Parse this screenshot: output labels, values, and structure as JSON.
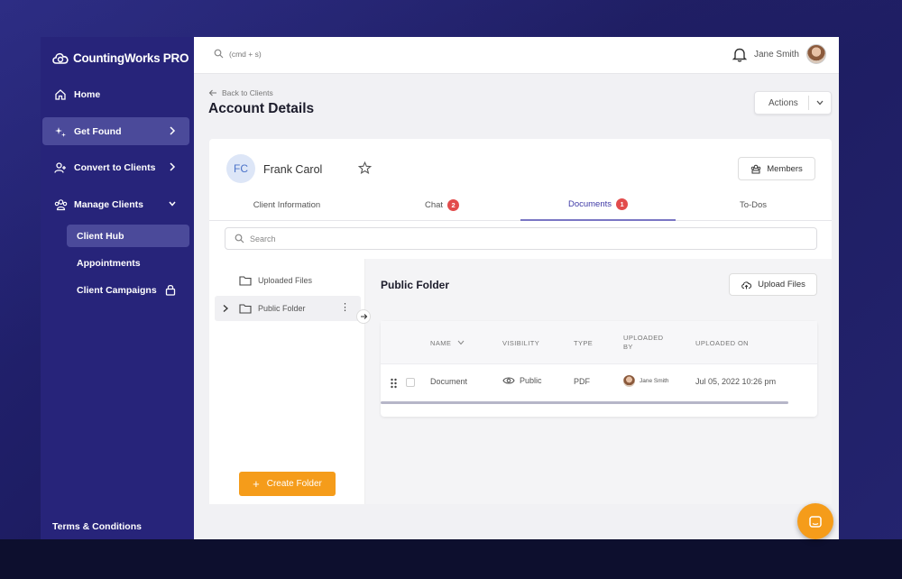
{
  "brand": {
    "name": "CountingWorks PRO",
    "accent": "#27247a",
    "orange": "#f59c1a"
  },
  "sidebar": {
    "items": [
      {
        "label": "Home",
        "icon": "home-icon"
      },
      {
        "label": "Get Found",
        "icon": "sparkle-icon",
        "active": true
      },
      {
        "label": "Convert to Clients",
        "icon": "user-add-icon"
      },
      {
        "label": "Manage Clients",
        "icon": "users-icon",
        "expanded": true
      }
    ],
    "subitems": [
      {
        "label": "Client Hub",
        "active": true
      },
      {
        "label": "Appointments"
      },
      {
        "label": "Client Campaigns",
        "locked": true
      }
    ],
    "terms": "Terms & Conditions"
  },
  "topbar": {
    "search_placeholder": "(cmd + s)",
    "user_name": "Jane Smith"
  },
  "header": {
    "back_label": "Back to Clients",
    "title": "Account Details",
    "actions_label": "Actions"
  },
  "client": {
    "initials": "FC",
    "name": "Frank Carol",
    "members_label": "Members"
  },
  "tabs": [
    {
      "label": "Client Information",
      "badge": null
    },
    {
      "label": "Chat",
      "badge": "2"
    },
    {
      "label": "Documents",
      "badge": "1",
      "active": true
    },
    {
      "label": "To-Dos",
      "badge": null
    }
  ],
  "documents": {
    "search_placeholder": "Search",
    "folders": [
      {
        "label": "Uploaded Files"
      },
      {
        "label": "Public Folder",
        "active": true
      }
    ],
    "create_folder_label": "Create Folder",
    "folder_title": "Public Folder",
    "upload_label": "Upload Files",
    "columns": [
      "NAME",
      "VISIBILITY",
      "TYPE",
      "UPLOADED BY",
      "UPLOADED ON"
    ],
    "rows": [
      {
        "name": "Document",
        "visibility": "Public",
        "type": "PDF",
        "uploaded_by": "Jane Smith",
        "uploaded_on": "Jul 05, 2022 10:26 pm"
      }
    ]
  }
}
